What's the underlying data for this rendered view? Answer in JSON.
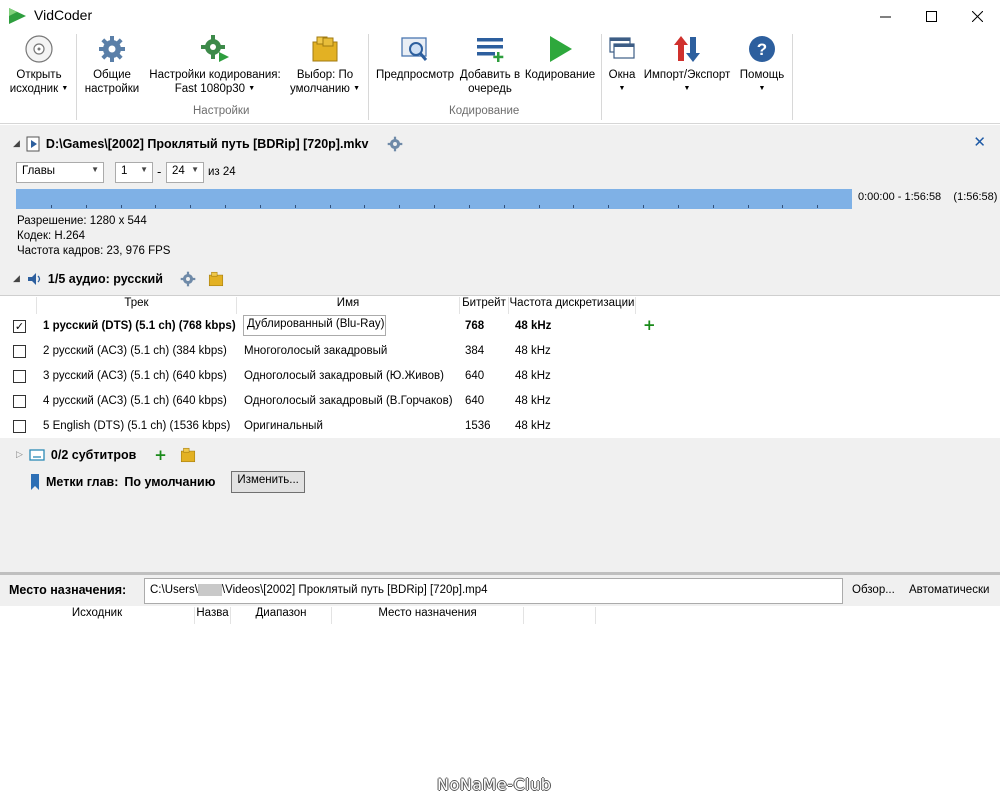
{
  "window": {
    "title": "VidCoder"
  },
  "ribbon": {
    "open_source": "Открыть\nисходник",
    "general_settings_1": "Общие",
    "general_settings_2": "настройки",
    "encoding_settings_1": "Настройки кодирования:",
    "encoding_settings_2": "Fast 1080p30",
    "pick_1": "Выбор: По",
    "pick_2": "умолчанию",
    "preview": "Предпросмотр",
    "add_queue_1": "Добавить в",
    "add_queue_2": "очередь",
    "encode": "Кодирование",
    "windows": "Окна",
    "import_export": "Импорт/Экспорт",
    "help": "Помощь",
    "group_settings": "Настройки",
    "group_encoding": "Кодирование",
    "open_source_1": "Открыть",
    "open_source_2": "исходник"
  },
  "source": {
    "path": "D:\\Games\\[2002] Проклятый путь [BDRip] [720p].mkv",
    "range_type": "Главы",
    "range_start": "1",
    "range_end": "24",
    "range_of": "из 24",
    "time_range": "0:00:00 - 1:56:58",
    "duration": "(1:56:58)",
    "resolution": "Разрешение: 1280 x 544",
    "codec": "Кодек: H.264",
    "framerate": "Частота кадров: 23, 976 FPS"
  },
  "audio": {
    "title": "1/5 аудио: русский",
    "columns": [
      "Трек",
      "Имя",
      "Битрейт",
      "Частота дискретизации"
    ],
    "rows": [
      {
        "checked": true,
        "track": "1 русский (DTS) (5.1 ch) (768 kbps)",
        "name": "Дублированный (Blu-Ray)",
        "bitrate": "768",
        "rate": "48 kHz"
      },
      {
        "checked": false,
        "track": "2 русский (AC3) (5.1 ch) (384 kbps)",
        "name": "Многоголосый закадровый",
        "bitrate": "384",
        "rate": "48 kHz"
      },
      {
        "checked": false,
        "track": "3 русский (AC3) (5.1 ch) (640 kbps)",
        "name": "Одноголосый закадровый (Ю.Живов)",
        "bitrate": "640",
        "rate": "48 kHz"
      },
      {
        "checked": false,
        "track": "4 русский (AC3) (5.1 ch) (640 kbps)",
        "name": "Одноголосый закадровый (В.Горчаков)",
        "bitrate": "640",
        "rate": "48 kHz"
      },
      {
        "checked": false,
        "track": "5 English (DTS) (5.1 ch) (1536 kbps)",
        "name": "Оригинальный",
        "bitrate": "1536",
        "rate": "48 kHz"
      }
    ]
  },
  "subtitles": {
    "title": "0/2 субтитров"
  },
  "chapters": {
    "label": "Метки глав:",
    "value": "По умолчанию",
    "change_button": "Изменить..."
  },
  "destination": {
    "label": "Место назначения:",
    "path_prefix": "C:\\Users\\",
    "path_suffix": "\\Videos\\[2002] Проклятый путь [BDRip] [720p].mp4",
    "browse": "Обзор...",
    "auto": "Автоматически"
  },
  "queue": {
    "columns": [
      "Исходник",
      "Назва",
      "Диапазон",
      "Место назначения"
    ]
  },
  "watermark": "NoNaMe-Club",
  "colors": {
    "timeline": "#7fb1e6",
    "accent_blue": "#1e5aa6",
    "green_plus": "#1a8a1a"
  }
}
